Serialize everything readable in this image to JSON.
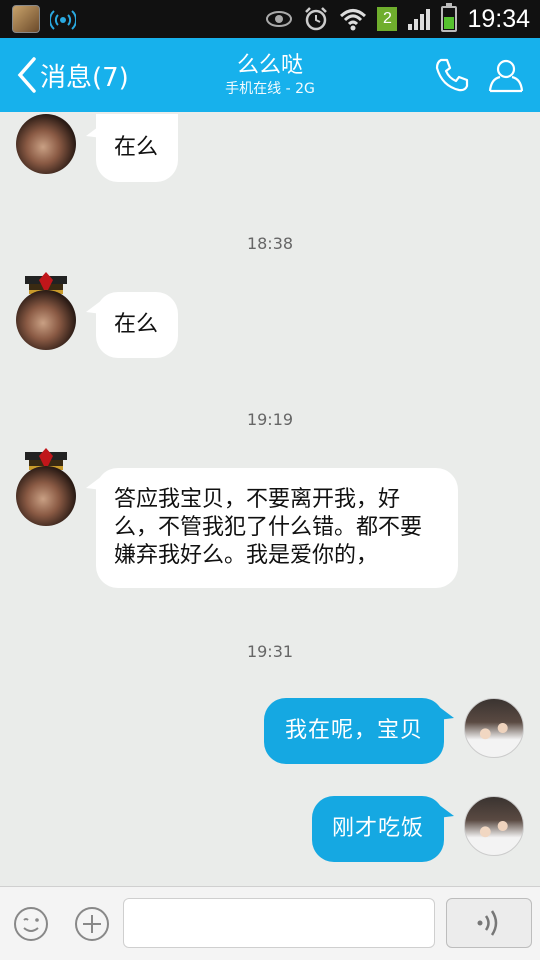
{
  "status_bar": {
    "sim_slot": "2",
    "time": "19:34",
    "icons": [
      "app-avatar-icon",
      "qq-signal-icon",
      "eye-icon",
      "alarm-icon",
      "wifi-icon",
      "signal-bars-icon",
      "battery-icon"
    ]
  },
  "header": {
    "back_label": "消息(7)",
    "title": "么么哒",
    "subtitle": "手机在线 - 2G",
    "icons": [
      "phone-icon",
      "profile-icon"
    ],
    "accent_color": "#17b1ec"
  },
  "timestamps": [
    "18:38",
    "19:19",
    "19:31"
  ],
  "messages": [
    {
      "side": "in",
      "text": "在么"
    },
    {
      "side": "in",
      "text": "在么"
    },
    {
      "side": "in",
      "lines": [
        "答应我宝贝，不要离开我，好",
        "么，不管我犯了什么错。都不要",
        "嫌弃我好么。我是爱你的，"
      ]
    },
    {
      "side": "out",
      "text": "我在呢，宝贝"
    },
    {
      "side": "out",
      "text": "刚才吃饭"
    }
  ],
  "input_bar": {
    "placeholder": "",
    "icons": [
      "emoji-icon",
      "plus-icon",
      "voice-icon"
    ]
  }
}
